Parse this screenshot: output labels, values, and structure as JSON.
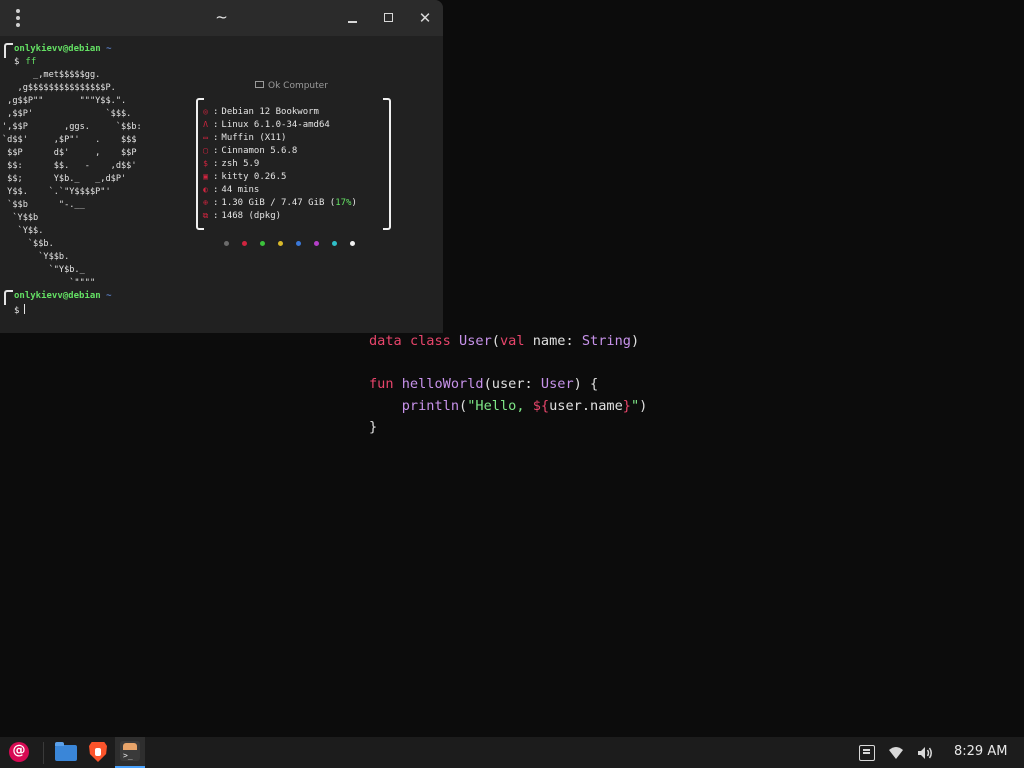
{
  "terminal": {
    "title": "~",
    "first_prompt": {
      "user_host": "onlykievv@debian",
      "dir": "~",
      "symbol": "$",
      "command": "ff"
    },
    "second_prompt": {
      "user_host": "onlykievv@debian",
      "dir": "~",
      "symbol": "$",
      "command": ""
    },
    "logo_lines": [
      "      _,met$$$$$gg.",
      "   ,g$$$$$$$$$$$$$$$P.",
      " ,g$$P\"\"       \"\"\"Y$$.\".",
      " ,$$P'              `$$$.",
      "',$$P       ,ggs.     `$$b:",
      "`d$$'     ,$P\"'   .    $$$",
      " $$P      d$'     ,    $$P",
      " $$:      $$.   -    ,d$$'",
      " $$;      Y$b._   _,d$P'",
      " Y$$.    `.`\"Y$$$$P\"'",
      " `$$b      \"-.__",
      "  `Y$$b",
      "   `Y$$.",
      "     `$$b.",
      "       `Y$$b.",
      "         `\"Y$b._",
      "             `\"\"\"\""
    ],
    "info_header": "Ok Computer",
    "info": [
      {
        "icon": "debian-icon",
        "glyph": "◎",
        "value": "Debian 12 Bookworm"
      },
      {
        "icon": "linux-icon",
        "glyph": "Λ",
        "value": "Linux 6.1.0-34-amd64"
      },
      {
        "icon": "window-manager-icon",
        "glyph": "▭",
        "value": "Muffin (X11)"
      },
      {
        "icon": "desktop-icon",
        "glyph": "▢",
        "value": "Cinnamon 5.6.8"
      },
      {
        "icon": "shell-icon",
        "glyph": "$",
        "value": "zsh 5.9"
      },
      {
        "icon": "terminal-icon",
        "glyph": "▣",
        "value": "kitty 0.26.5"
      },
      {
        "icon": "uptime-icon",
        "glyph": "◐",
        "value": "44 mins"
      },
      {
        "icon": "memory-icon",
        "glyph": "⊕",
        "value_main": "1.30 GiB / 7.47 GiB (",
        "value_pct": "17%",
        "value_end": ")"
      },
      {
        "icon": "packages-icon",
        "glyph": "⧉",
        "value": "1468 (dpkg)"
      }
    ],
    "swatch_colors": [
      "#6b6b6b",
      "#d0243f",
      "#3cc23c",
      "#d9b92a",
      "#3a78d8",
      "#b43fc8",
      "#2fbfc8",
      "#f0f0f0"
    ]
  },
  "desktop_code": {
    "line1": {
      "kw1": "data",
      "kw2": "class",
      "cls": "User",
      "p1": "(",
      "kw3": "val",
      "arg": " name: ",
      "ty": "String",
      "p2": ")"
    },
    "line3": {
      "kw": "fun",
      "fn": "helloWorld",
      "p1": "(user: ",
      "ty": "User",
      "p2": ") {"
    },
    "line4": {
      "indent": "    ",
      "fn": "println",
      "p1": "(",
      "s1": "\"Hello, ",
      "i1": "${",
      "expr": "user.name",
      "i2": "}",
      "s2": "\"",
      "p2": ")"
    },
    "line5": "}"
  },
  "taskbar": {
    "clock": "8:29 AM"
  },
  "colors": {
    "accent": "#4aa3ff",
    "debian_red": "#d70a53",
    "prompt_green": "#64e064"
  }
}
